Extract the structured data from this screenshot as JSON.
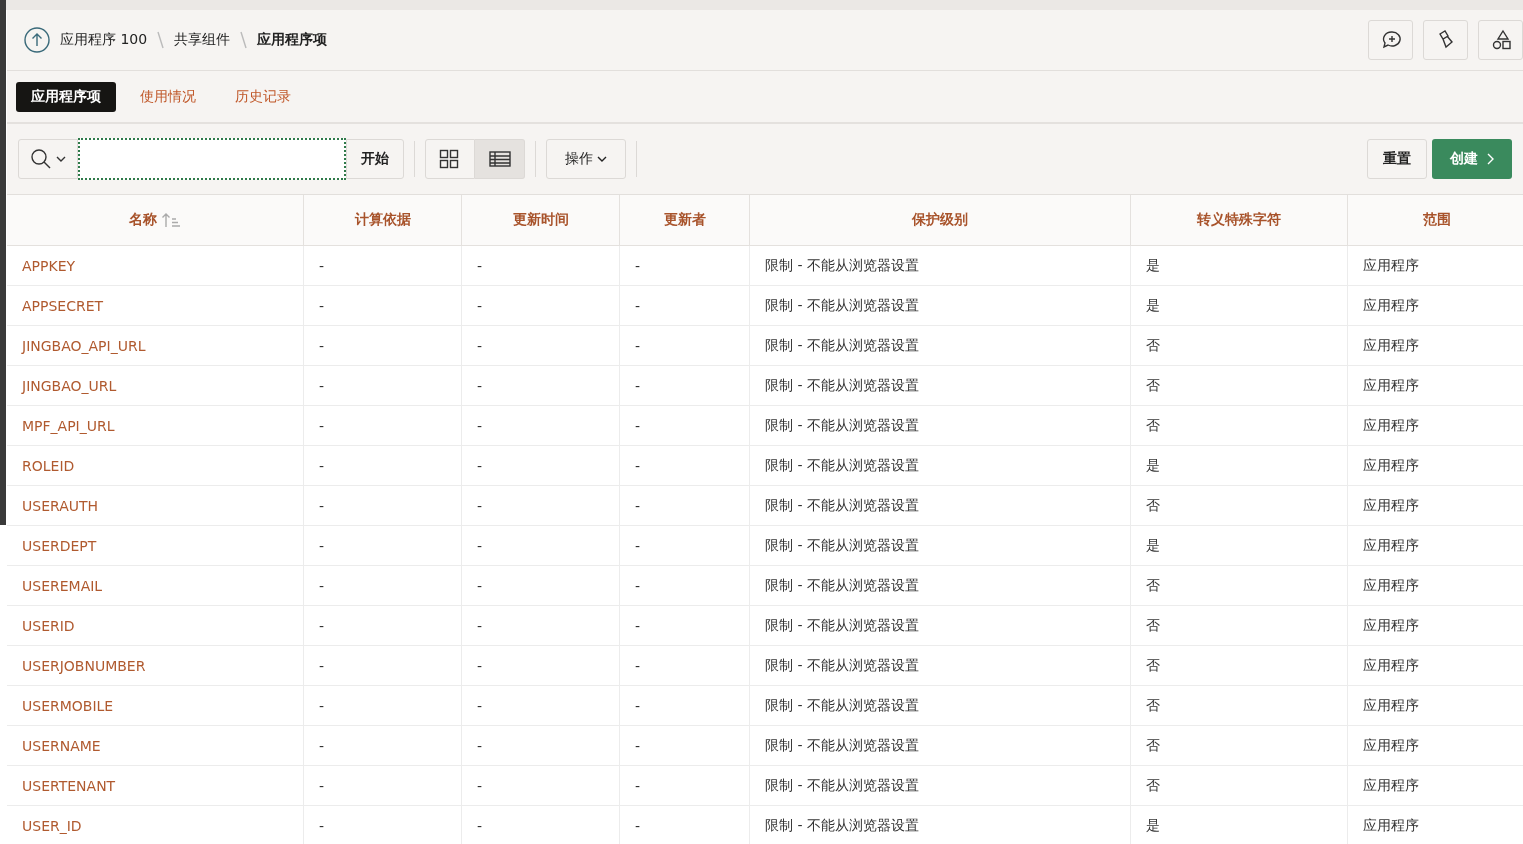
{
  "breadcrumb": [
    "应用程序 100",
    "共享组件",
    "应用程序项"
  ],
  "tabs": [
    {
      "label": "应用程序项",
      "selected": true
    },
    {
      "label": "使用情况",
      "selected": false
    },
    {
      "label": "历史记录",
      "selected": false
    }
  ],
  "toolbar": {
    "go": "开始",
    "views": [
      {
        "kind": "icons",
        "selected": false
      },
      {
        "kind": "report",
        "selected": true
      }
    ],
    "actions": "操作",
    "reset": "重置",
    "create": "创建"
  },
  "table": {
    "columns": [
      {
        "label": "名称",
        "sorted": true
      },
      {
        "label": "计算依据",
        "sorted": false
      },
      {
        "label": "更新时间",
        "sorted": false
      },
      {
        "label": "更新者",
        "sorted": false
      },
      {
        "label": "保护级别",
        "sorted": false
      },
      {
        "label": "转义特殊字符",
        "sorted": false
      },
      {
        "label": "范围",
        "sorted": false
      }
    ],
    "rows": [
      [
        "APPKEY",
        "-",
        "-",
        "-",
        "限制 - 不能从浏览器设置",
        "是",
        "应用程序"
      ],
      [
        "APPSECRET",
        "-",
        "-",
        "-",
        "限制 - 不能从浏览器设置",
        "是",
        "应用程序"
      ],
      [
        "JINGBAO_API_URL",
        "-",
        "-",
        "-",
        "限制 - 不能从浏览器设置",
        "否",
        "应用程序"
      ],
      [
        "JINGBAO_URL",
        "-",
        "-",
        "-",
        "限制 - 不能从浏览器设置",
        "否",
        "应用程序"
      ],
      [
        "MPF_API_URL",
        "-",
        "-",
        "-",
        "限制 - 不能从浏览器设置",
        "否",
        "应用程序"
      ],
      [
        "ROLEID",
        "-",
        "-",
        "-",
        "限制 - 不能从浏览器设置",
        "是",
        "应用程序"
      ],
      [
        "USERAUTH",
        "-",
        "-",
        "-",
        "限制 - 不能从浏览器设置",
        "否",
        "应用程序"
      ],
      [
        "USERDEPT",
        "-",
        "-",
        "-",
        "限制 - 不能从浏览器设置",
        "是",
        "应用程序"
      ],
      [
        "USEREMAIL",
        "-",
        "-",
        "-",
        "限制 - 不能从浏览器设置",
        "否",
        "应用程序"
      ],
      [
        "USERID",
        "-",
        "-",
        "-",
        "限制 - 不能从浏览器设置",
        "否",
        "应用程序"
      ],
      [
        "USERJOBNUMBER",
        "-",
        "-",
        "-",
        "限制 - 不能从浏览器设置",
        "否",
        "应用程序"
      ],
      [
        "USERMOBILE",
        "-",
        "-",
        "-",
        "限制 - 不能从浏览器设置",
        "否",
        "应用程序"
      ],
      [
        "USERNAME",
        "-",
        "-",
        "-",
        "限制 - 不能从浏览器设置",
        "否",
        "应用程序"
      ],
      [
        "USERTENANT",
        "-",
        "-",
        "-",
        "限制 - 不能从浏览器设置",
        "否",
        "应用程序"
      ],
      [
        "USER_ID",
        "-",
        "-",
        "-",
        "限制 - 不能从浏览器设置",
        "是",
        "应用程序"
      ]
    ]
  }
}
